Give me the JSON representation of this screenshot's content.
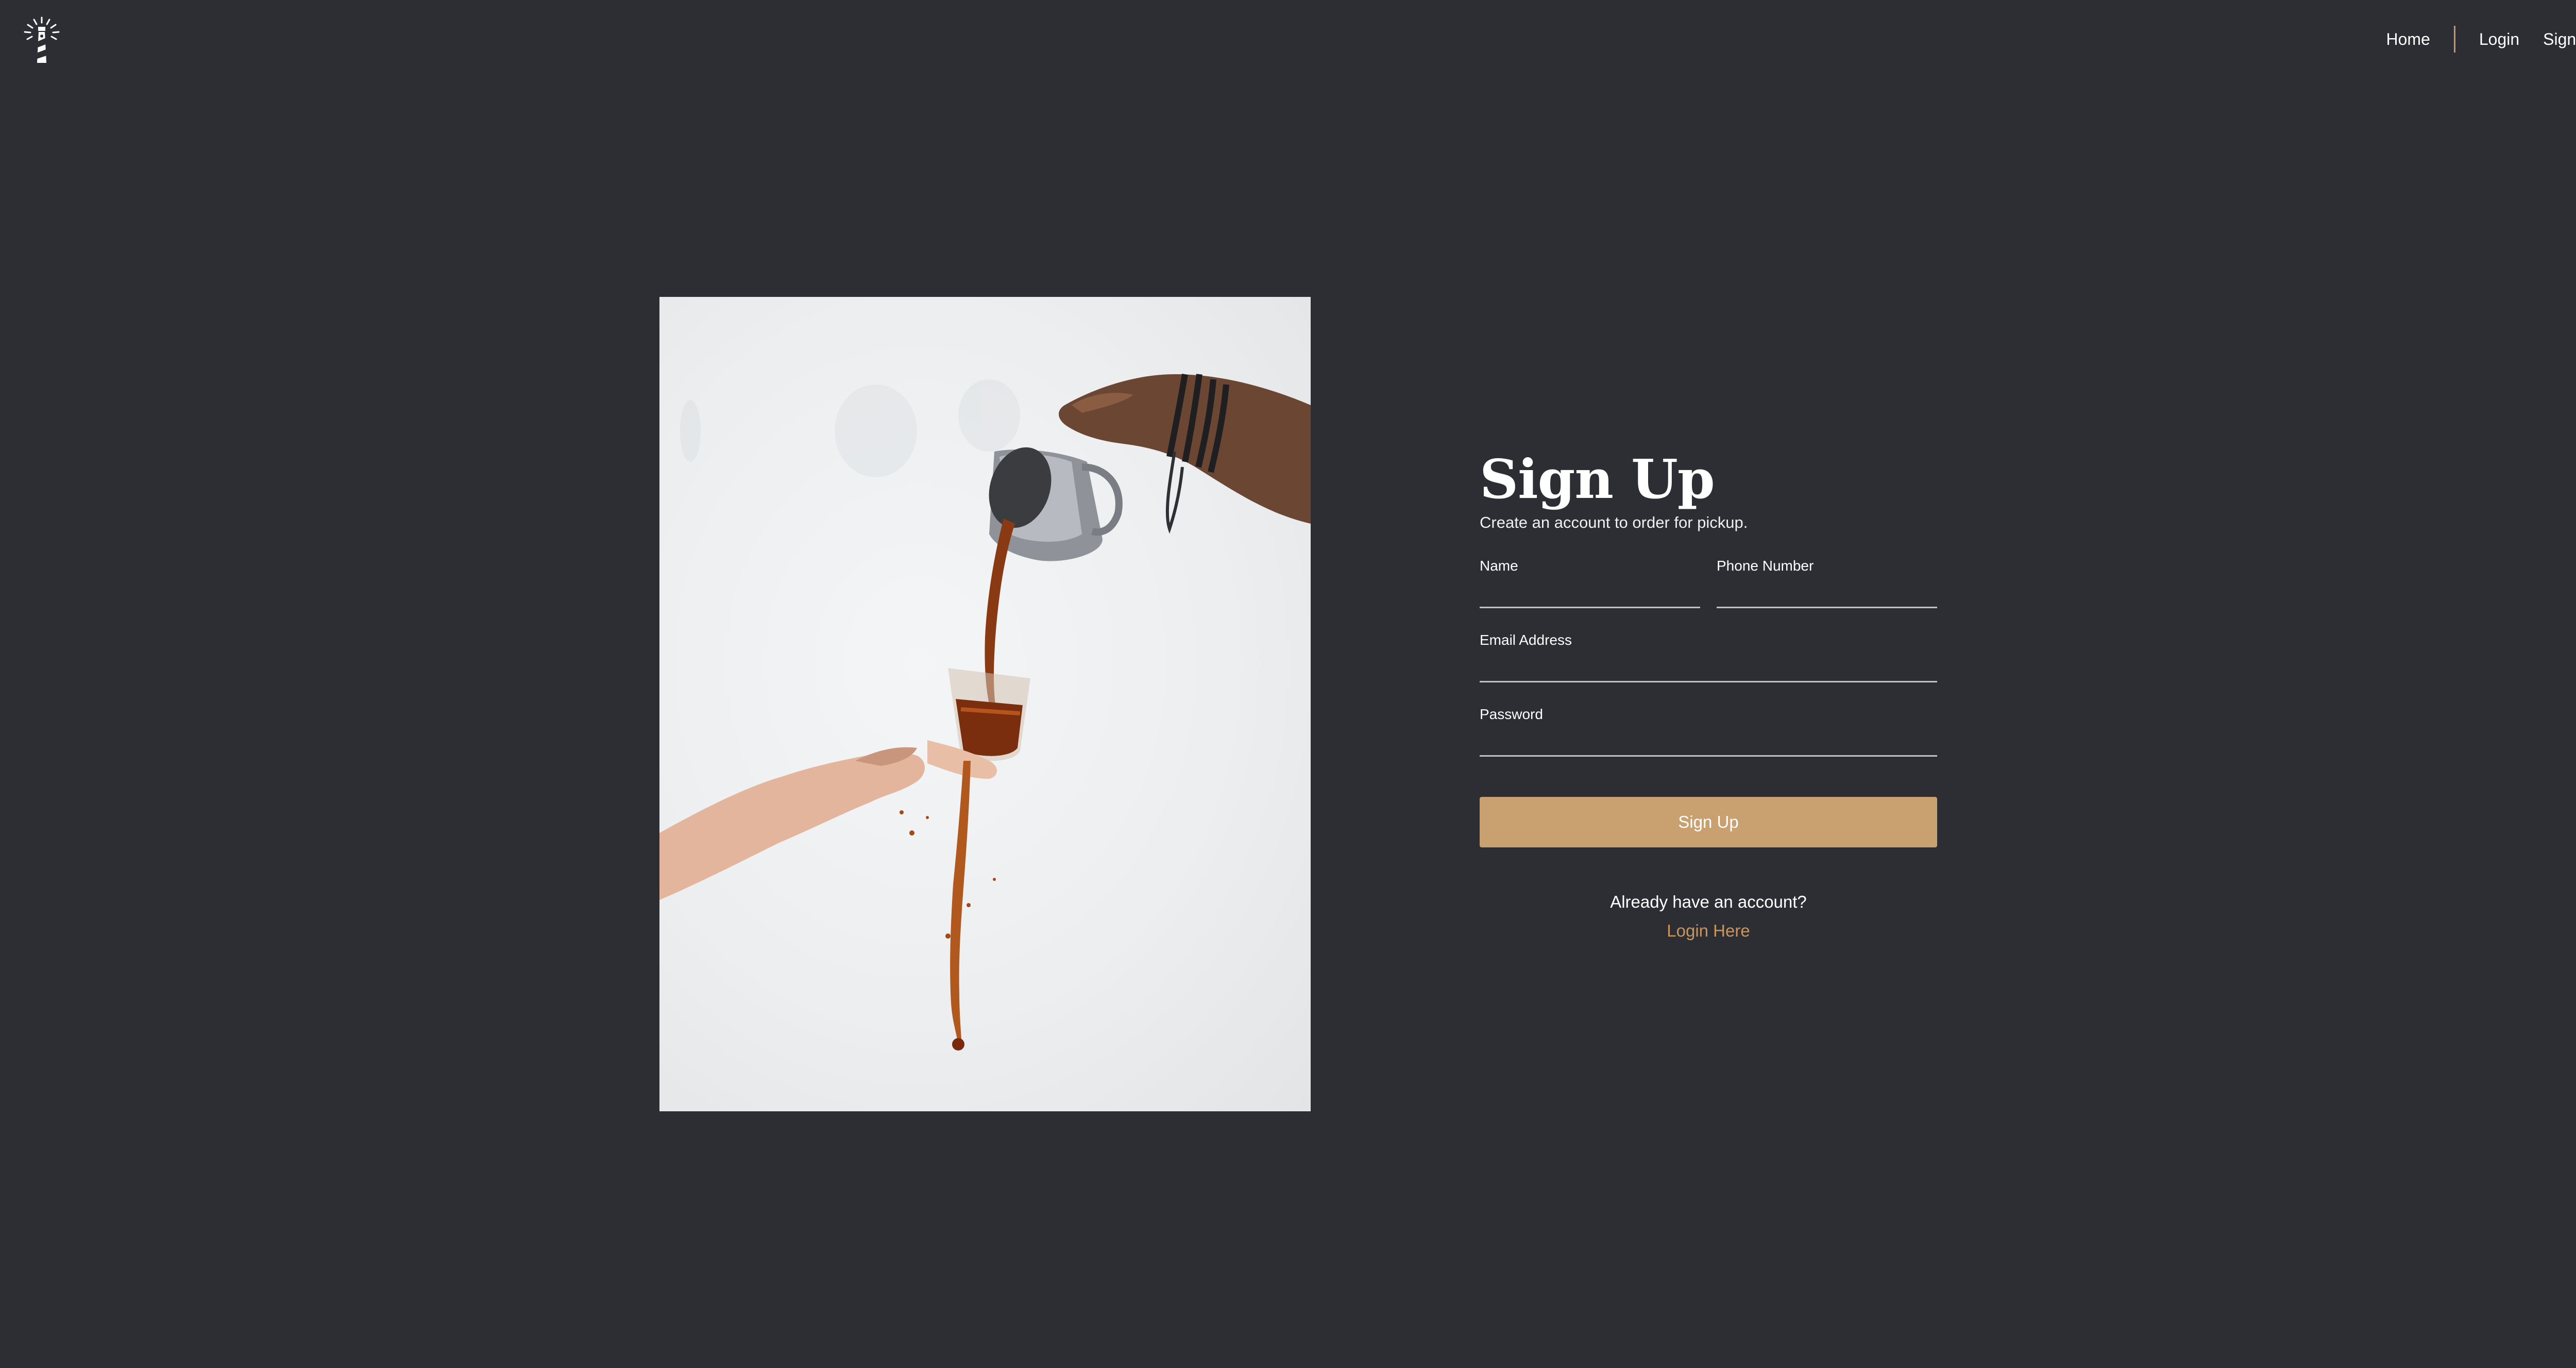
{
  "nav": {
    "home_label": "Home",
    "login_label": "Login",
    "signup_label": "Sign Up"
  },
  "logo": {
    "icon": "lighthouse-icon"
  },
  "hero_image": {
    "subject": "coffee-pour-photo"
  },
  "form": {
    "title": "Sign Up",
    "subtitle": "Create an account to order for pickup.",
    "fields": {
      "name": {
        "label": "Name",
        "value": ""
      },
      "phone": {
        "label": "Phone Number",
        "value": ""
      },
      "email": {
        "label": "Email Address",
        "value": ""
      },
      "password": {
        "label": "Password",
        "value": ""
      }
    },
    "submit_label": "Sign Up",
    "already_text": "Already have an account?",
    "login_link": "Login Here"
  },
  "colors": {
    "background": "#2c2e33",
    "accent": "#c9a06f",
    "link": "#c9955f",
    "text": "#ffffff"
  }
}
